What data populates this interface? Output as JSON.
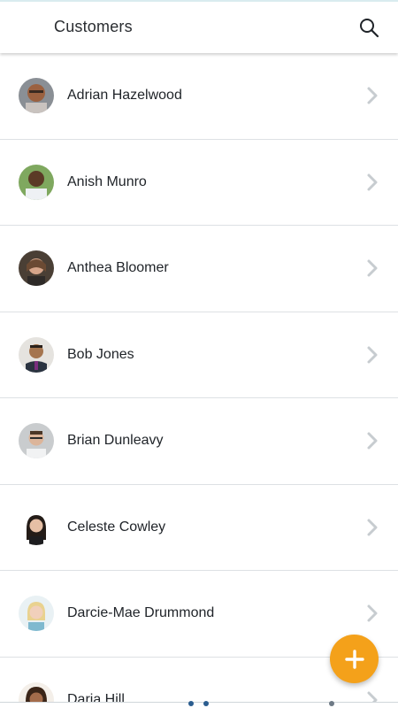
{
  "header": {
    "title": "Customers",
    "search_icon": "search-icon"
  },
  "customers": [
    {
      "name": "Adrian Hazelwood"
    },
    {
      "name": "Anish Munro"
    },
    {
      "name": "Anthea Bloomer"
    },
    {
      "name": "Bob Jones"
    },
    {
      "name": "Brian Dunleavy"
    },
    {
      "name": "Celeste Cowley"
    },
    {
      "name": "Darcie-Mae Drummond"
    },
    {
      "name": "Daria Hill"
    }
  ],
  "fab": {
    "icon": "plus-icon",
    "color": "#f4a11a"
  },
  "colors": {
    "divider": "#dde1e4",
    "chevron": "#c7ccd0",
    "text": "#1f2328"
  }
}
